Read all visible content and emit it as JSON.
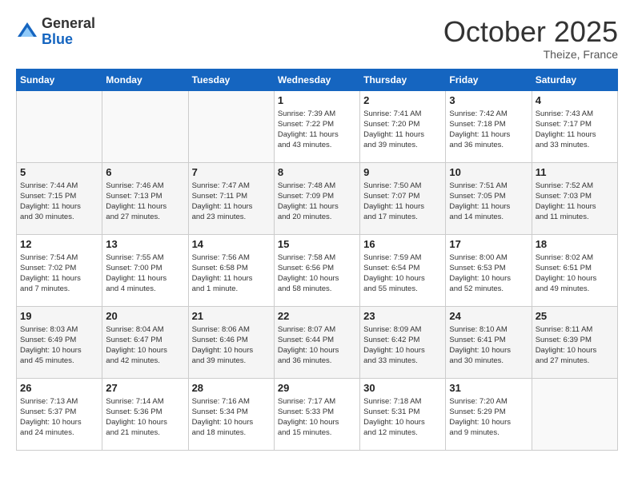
{
  "header": {
    "logo_line1": "General",
    "logo_line2": "Blue",
    "month_title": "October 2025",
    "location": "Theize, France"
  },
  "weekdays": [
    "Sunday",
    "Monday",
    "Tuesday",
    "Wednesday",
    "Thursday",
    "Friday",
    "Saturday"
  ],
  "weeks": [
    [
      {
        "day": "",
        "info": ""
      },
      {
        "day": "",
        "info": ""
      },
      {
        "day": "",
        "info": ""
      },
      {
        "day": "1",
        "info": "Sunrise: 7:39 AM\nSunset: 7:22 PM\nDaylight: 11 hours\nand 43 minutes."
      },
      {
        "day": "2",
        "info": "Sunrise: 7:41 AM\nSunset: 7:20 PM\nDaylight: 11 hours\nand 39 minutes."
      },
      {
        "day": "3",
        "info": "Sunrise: 7:42 AM\nSunset: 7:18 PM\nDaylight: 11 hours\nand 36 minutes."
      },
      {
        "day": "4",
        "info": "Sunrise: 7:43 AM\nSunset: 7:17 PM\nDaylight: 11 hours\nand 33 minutes."
      }
    ],
    [
      {
        "day": "5",
        "info": "Sunrise: 7:44 AM\nSunset: 7:15 PM\nDaylight: 11 hours\nand 30 minutes."
      },
      {
        "day": "6",
        "info": "Sunrise: 7:46 AM\nSunset: 7:13 PM\nDaylight: 11 hours\nand 27 minutes."
      },
      {
        "day": "7",
        "info": "Sunrise: 7:47 AM\nSunset: 7:11 PM\nDaylight: 11 hours\nand 23 minutes."
      },
      {
        "day": "8",
        "info": "Sunrise: 7:48 AM\nSunset: 7:09 PM\nDaylight: 11 hours\nand 20 minutes."
      },
      {
        "day": "9",
        "info": "Sunrise: 7:50 AM\nSunset: 7:07 PM\nDaylight: 11 hours\nand 17 minutes."
      },
      {
        "day": "10",
        "info": "Sunrise: 7:51 AM\nSunset: 7:05 PM\nDaylight: 11 hours\nand 14 minutes."
      },
      {
        "day": "11",
        "info": "Sunrise: 7:52 AM\nSunset: 7:03 PM\nDaylight: 11 hours\nand 11 minutes."
      }
    ],
    [
      {
        "day": "12",
        "info": "Sunrise: 7:54 AM\nSunset: 7:02 PM\nDaylight: 11 hours\nand 7 minutes."
      },
      {
        "day": "13",
        "info": "Sunrise: 7:55 AM\nSunset: 7:00 PM\nDaylight: 11 hours\nand 4 minutes."
      },
      {
        "day": "14",
        "info": "Sunrise: 7:56 AM\nSunset: 6:58 PM\nDaylight: 11 hours\nand 1 minute."
      },
      {
        "day": "15",
        "info": "Sunrise: 7:58 AM\nSunset: 6:56 PM\nDaylight: 10 hours\nand 58 minutes."
      },
      {
        "day": "16",
        "info": "Sunrise: 7:59 AM\nSunset: 6:54 PM\nDaylight: 10 hours\nand 55 minutes."
      },
      {
        "day": "17",
        "info": "Sunrise: 8:00 AM\nSunset: 6:53 PM\nDaylight: 10 hours\nand 52 minutes."
      },
      {
        "day": "18",
        "info": "Sunrise: 8:02 AM\nSunset: 6:51 PM\nDaylight: 10 hours\nand 49 minutes."
      }
    ],
    [
      {
        "day": "19",
        "info": "Sunrise: 8:03 AM\nSunset: 6:49 PM\nDaylight: 10 hours\nand 45 minutes."
      },
      {
        "day": "20",
        "info": "Sunrise: 8:04 AM\nSunset: 6:47 PM\nDaylight: 10 hours\nand 42 minutes."
      },
      {
        "day": "21",
        "info": "Sunrise: 8:06 AM\nSunset: 6:46 PM\nDaylight: 10 hours\nand 39 minutes."
      },
      {
        "day": "22",
        "info": "Sunrise: 8:07 AM\nSunset: 6:44 PM\nDaylight: 10 hours\nand 36 minutes."
      },
      {
        "day": "23",
        "info": "Sunrise: 8:09 AM\nSunset: 6:42 PM\nDaylight: 10 hours\nand 33 minutes."
      },
      {
        "day": "24",
        "info": "Sunrise: 8:10 AM\nSunset: 6:41 PM\nDaylight: 10 hours\nand 30 minutes."
      },
      {
        "day": "25",
        "info": "Sunrise: 8:11 AM\nSunset: 6:39 PM\nDaylight: 10 hours\nand 27 minutes."
      }
    ],
    [
      {
        "day": "26",
        "info": "Sunrise: 7:13 AM\nSunset: 5:37 PM\nDaylight: 10 hours\nand 24 minutes."
      },
      {
        "day": "27",
        "info": "Sunrise: 7:14 AM\nSunset: 5:36 PM\nDaylight: 10 hours\nand 21 minutes."
      },
      {
        "day": "28",
        "info": "Sunrise: 7:16 AM\nSunset: 5:34 PM\nDaylight: 10 hours\nand 18 minutes."
      },
      {
        "day": "29",
        "info": "Sunrise: 7:17 AM\nSunset: 5:33 PM\nDaylight: 10 hours\nand 15 minutes."
      },
      {
        "day": "30",
        "info": "Sunrise: 7:18 AM\nSunset: 5:31 PM\nDaylight: 10 hours\nand 12 minutes."
      },
      {
        "day": "31",
        "info": "Sunrise: 7:20 AM\nSunset: 5:29 PM\nDaylight: 10 hours\nand 9 minutes."
      },
      {
        "day": "",
        "info": ""
      }
    ]
  ]
}
